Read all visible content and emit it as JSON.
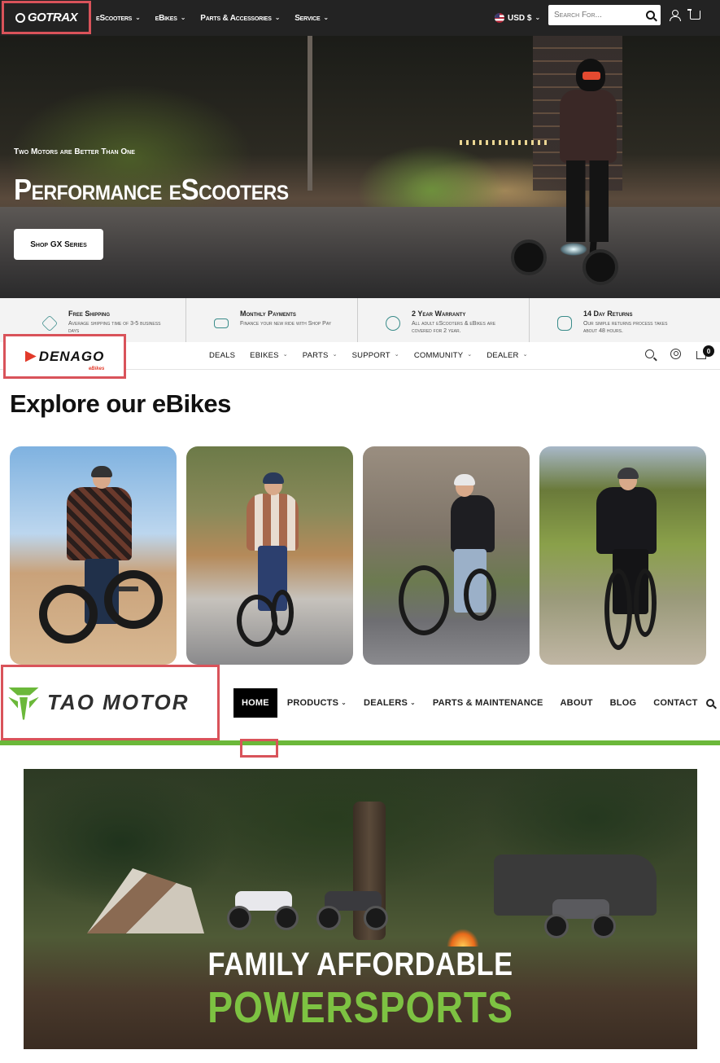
{
  "gotrax": {
    "logo": "GOTRAX",
    "menu": [
      {
        "label": "eScooters"
      },
      {
        "label": "eBikes"
      },
      {
        "label": "Parts & Accessories"
      },
      {
        "label": "Service"
      }
    ],
    "currency": "USD $",
    "search_placeholder": "Search For...",
    "hero": {
      "tagline": "Two Motors are Better Than One",
      "headline": "Performance eScooters",
      "cta": "Shop GX Series",
      "slide_count": 2,
      "active_slide": 1
    },
    "features": [
      {
        "title": "Free Shipping",
        "desc": "Average shipping time of 3-5 business days",
        "icon": "box-icon"
      },
      {
        "title": "Monthly Payments",
        "desc": "Finance your new ride with Shop Pay",
        "icon": "cash-icon"
      },
      {
        "title": "2 Year Warranty",
        "desc": "All adult eScooters & eBikes are covered for 2 year.",
        "icon": "badge-icon"
      },
      {
        "title": "14 Day Returns",
        "desc": "Our simple returns process takes about 48 hours.",
        "icon": "return-icon"
      }
    ],
    "accent": "#3a8c8a"
  },
  "denago": {
    "logo": "DENAGO",
    "logo_sub": "eBikes",
    "menu": [
      {
        "label": "DEALS",
        "dropdown": false
      },
      {
        "label": "EBIKES",
        "dropdown": true
      },
      {
        "label": "PARTS",
        "dropdown": true
      },
      {
        "label": "SUPPORT",
        "dropdown": true
      },
      {
        "label": "COMMUNITY",
        "dropdown": true
      },
      {
        "label": "DEALER",
        "dropdown": true
      }
    ],
    "cart_count": "0",
    "heading": "Explore our eBikes",
    "brand_color": "#e23a2a"
  },
  "tao": {
    "logo": "TAO MOTOR",
    "menu": [
      {
        "label": "HOME",
        "active": true,
        "dropdown": false
      },
      {
        "label": "PRODUCTS",
        "active": false,
        "dropdown": true
      },
      {
        "label": "DEALERS",
        "active": false,
        "dropdown": true
      },
      {
        "label": "PARTS & MAINTENANCE",
        "active": false,
        "dropdown": false
      },
      {
        "label": "ABOUT",
        "active": false,
        "dropdown": false
      },
      {
        "label": "BLOG",
        "active": false,
        "dropdown": false
      },
      {
        "label": "CONTACT",
        "active": false,
        "dropdown": false
      }
    ],
    "hero": {
      "line1": "FAMILY AFFORDABLE",
      "line2": "POWERSPORTS"
    },
    "accent": "#6bb83a"
  },
  "highlight_color": "#d9535a"
}
